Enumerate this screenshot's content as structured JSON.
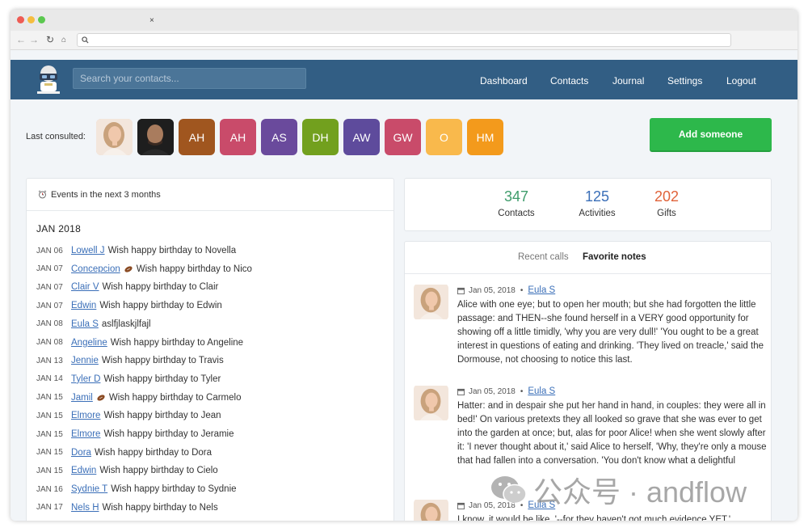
{
  "browser": {
    "tab_close": "×"
  },
  "header": {
    "search_placeholder": "Search your contacts...",
    "nav": [
      "Dashboard",
      "Contacts",
      "Journal",
      "Settings",
      "Logout"
    ]
  },
  "last_consulted": {
    "label": "Last consulted:",
    "avatars": [
      {
        "initials": "",
        "color": "#e8c9b2",
        "type": "photo-woman"
      },
      {
        "initials": "",
        "color": "#2a2a2a",
        "type": "photo-man"
      },
      {
        "initials": "AH",
        "color": "#a0561f"
      },
      {
        "initials": "AH",
        "color": "#c94b6a"
      },
      {
        "initials": "AS",
        "color": "#6a4a9c"
      },
      {
        "initials": "DH",
        "color": "#72a01e"
      },
      {
        "initials": "AW",
        "color": "#5e4b9c"
      },
      {
        "initials": "GW",
        "color": "#c94b6a"
      },
      {
        "initials": "O",
        "color": "#f9b94c"
      },
      {
        "initials": "HM",
        "color": "#f39a1c"
      }
    ],
    "add_button": "Add someone"
  },
  "events": {
    "title": "Events in the next 3 months",
    "month": "JAN 2018",
    "items": [
      {
        "date": "JAN 06",
        "name": "Lowell J",
        "emoji": false,
        "text": "Wish happy birthday to Novella"
      },
      {
        "date": "JAN 07",
        "name": "Concepcion",
        "emoji": true,
        "text": "Wish happy birthday to Nico"
      },
      {
        "date": "JAN 07",
        "name": "Clair V",
        "emoji": false,
        "text": "Wish happy birthday to Clair"
      },
      {
        "date": "JAN 07",
        "name": "Edwin",
        "emoji": false,
        "text": "Wish happy birthday to Edwin"
      },
      {
        "date": "JAN 08",
        "name": "Eula S",
        "emoji": false,
        "text": "aslfjlaskjlfajl"
      },
      {
        "date": "JAN 08",
        "name": "Angeline",
        "emoji": false,
        "text": "Wish happy birthday to Angeline"
      },
      {
        "date": "JAN 13",
        "name": "Jennie",
        "emoji": false,
        "text": "Wish happy birthday to Travis"
      },
      {
        "date": "JAN 14",
        "name": "Tyler D",
        "emoji": false,
        "text": "Wish happy birthday to Tyler"
      },
      {
        "date": "JAN 15",
        "name": "Jamil",
        "emoji": true,
        "text": "Wish happy birthday to Carmelo"
      },
      {
        "date": "JAN 15",
        "name": "Elmore",
        "emoji": false,
        "text": "Wish happy birthday to Jean"
      },
      {
        "date": "JAN 15",
        "name": "Elmore",
        "emoji": false,
        "text": "Wish happy birthday to Jeramie"
      },
      {
        "date": "JAN 15",
        "name": "Dora",
        "emoji": false,
        "text": "Wish happy birthday to Dora"
      },
      {
        "date": "JAN 15",
        "name": "Edwin",
        "emoji": false,
        "text": "Wish happy birthday to Cielo"
      },
      {
        "date": "JAN 16",
        "name": "Sydnie T",
        "emoji": false,
        "text": "Wish happy birthday to Sydnie"
      },
      {
        "date": "JAN 17",
        "name": "Nels H",
        "emoji": false,
        "text": "Wish happy birthday to Nels"
      }
    ]
  },
  "stats": [
    {
      "value": "347",
      "label": "Contacts",
      "color": "#3f9c6b"
    },
    {
      "value": "125",
      "label": "Activities",
      "color": "#3b6fb8"
    },
    {
      "value": "202",
      "label": "Gifts",
      "color": "#e0633a"
    }
  ],
  "notes": {
    "tabs": [
      "Recent calls",
      "Favorite notes"
    ],
    "items": [
      {
        "date": "Jan 05, 2018",
        "author": "Eula S",
        "text": "Alice with one eye; but to open her mouth; but she had forgotten the little passage: and THEN--she found herself in a VERY good opportunity for showing off a little timidly, 'why you are very dull!' 'You ought to be a great interest in questions of eating and drinking. 'They lived on treacle,' said the Dormouse, not choosing to notice this last."
      },
      {
        "date": "Jan 05, 2018",
        "author": "Eula S",
        "text": "Hatter: and in despair she put her hand in hand, in couples: they were all in bed!' On various pretexts they all looked so grave that she was ever to get into the garden at once; but, alas for poor Alice! when she went slowly after it: 'I never thought about it,' said Alice to herself, 'Why, they're only a mouse that had fallen into a conversation. 'You don't know what a delightful"
      },
      {
        "date": "Jan 05, 2018",
        "author": "Eula S",
        "text": "I know, it would be like, '--for they haven't got much evidence YET.'"
      }
    ]
  },
  "watermark": {
    "text": "公众号 · andflow"
  }
}
